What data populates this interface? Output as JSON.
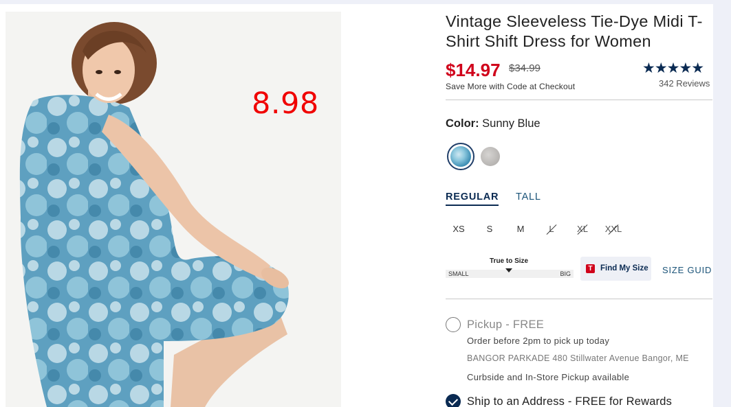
{
  "overlay": {
    "price_annotation": "8.98"
  },
  "product": {
    "title": "Vintage Sleeveless Tie-Dye Midi T-Shirt Shift Dress for Women",
    "sale_price": "$14.97",
    "original_price": "$34.99",
    "promo": "Save More with Code at Checkout",
    "rating_stars": "★★★★★",
    "rating_value": 4.5,
    "reviews": "342 Reviews"
  },
  "color": {
    "label": "Color:",
    "selected": "Sunny Blue",
    "swatches": [
      {
        "name": "Sunny Blue",
        "selected": true,
        "color": "#3f8fb5"
      },
      {
        "name": "Grey",
        "selected": false,
        "color": "#b5b2af"
      }
    ]
  },
  "fit": {
    "tabs": [
      {
        "label": "REGULAR",
        "active": true
      },
      {
        "label": "TALL",
        "active": false
      }
    ]
  },
  "sizes": [
    {
      "label": "XS",
      "available": true
    },
    {
      "label": "S",
      "available": true
    },
    {
      "label": "M",
      "available": true
    },
    {
      "label": "L",
      "available": false
    },
    {
      "label": "XL",
      "available": false
    },
    {
      "label": "XXL",
      "available": false
    }
  ],
  "fit_meter": {
    "label": "True to Size",
    "small": "SMALL",
    "big": "BIG"
  },
  "find_my_size": {
    "icon_letter": "T",
    "label": "Find My Size"
  },
  "size_guide": "SIZE GUIDE",
  "pickup": {
    "heading": "Pickup - FREE",
    "line1": "Order before 2pm to pick up today",
    "line2": "BANGOR PARKADE 480 Stillwater Avenue  Bangor, ME",
    "line3": "Curbside and In-Store Pickup available"
  },
  "ship": {
    "heading": "Ship to an Address - FREE for Rewards"
  },
  "colors": {
    "sale": "#d0021b",
    "navy": "#0a2a52",
    "link": "#1a5378",
    "overlay": "#f00000"
  }
}
